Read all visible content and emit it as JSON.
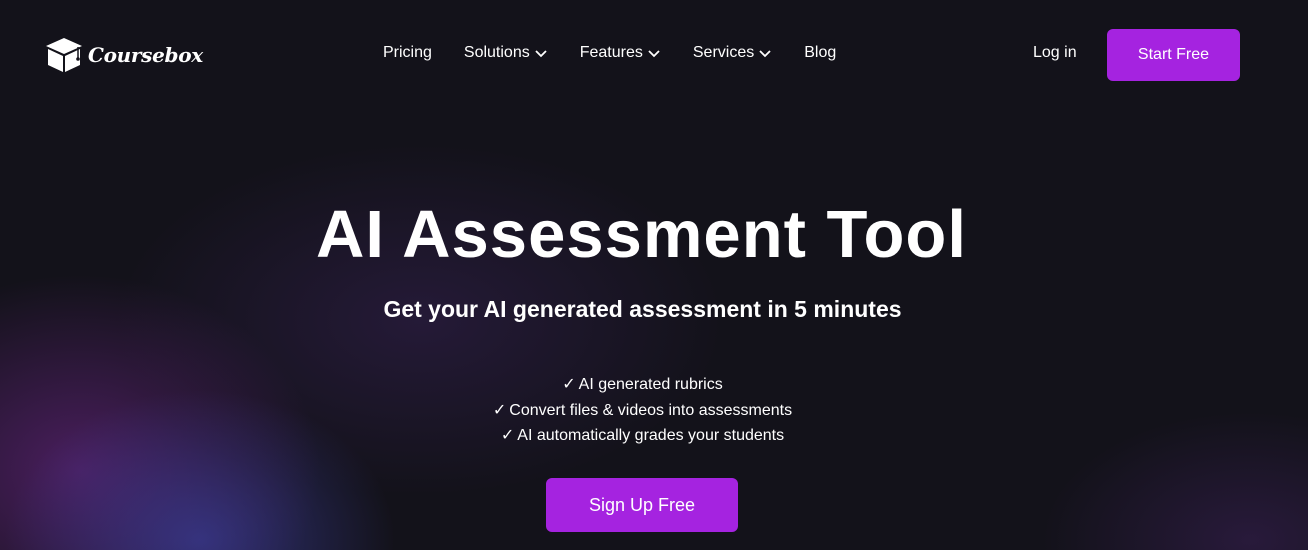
{
  "header": {
    "logo_text": "Coursebox",
    "nav": [
      {
        "label": "Pricing",
        "has_dropdown": false
      },
      {
        "label": "Solutions",
        "has_dropdown": true
      },
      {
        "label": "Features",
        "has_dropdown": true
      },
      {
        "label": "Services",
        "has_dropdown": true
      },
      {
        "label": "Blog",
        "has_dropdown": false
      }
    ],
    "login_label": "Log in",
    "start_label": "Start Free"
  },
  "hero": {
    "title": "AI Assessment Tool",
    "subtitle": "Get your AI generated assessment in 5 minutes",
    "check_symbol": "✓",
    "features": [
      "AI generated rubrics",
      "Convert files & videos into assessments",
      "AI automatically grades your students"
    ],
    "cta_label": "Sign Up Free"
  },
  "icons": {
    "logo": "graduation-cap-box-icon",
    "dropdown": "chevron-down-icon",
    "check": "checkmark-icon"
  },
  "colors": {
    "background": "#13121a",
    "accent": "#a523e0",
    "text": "#ffffff"
  }
}
